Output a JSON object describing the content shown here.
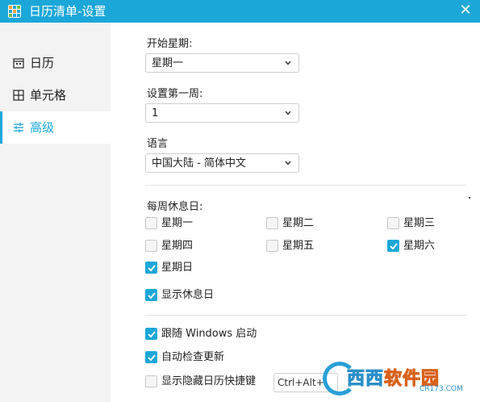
{
  "window": {
    "title": "日历清单-设置",
    "close_glyph": "✕"
  },
  "sidebar": {
    "items": [
      {
        "label": "日历",
        "icon": "calendar-icon",
        "active": false
      },
      {
        "label": "单元格",
        "icon": "grid-icon",
        "active": false
      },
      {
        "label": "高级",
        "icon": "sliders-icon",
        "active": true
      }
    ]
  },
  "settings": {
    "week_start": {
      "label": "开始星期:",
      "value": "星期一"
    },
    "first_week": {
      "label": "设置第一周:",
      "value": "1"
    },
    "language": {
      "label": "语言",
      "value": "中国大陆 - 简体中文"
    },
    "rest_days": {
      "label": "每周休息日:",
      "days": [
        {
          "label": "星期一",
          "checked": false
        },
        {
          "label": "星期二",
          "checked": false
        },
        {
          "label": "星期三",
          "checked": false
        },
        {
          "label": "星期四",
          "checked": false
        },
        {
          "label": "星期五",
          "checked": false
        },
        {
          "label": "星期六",
          "checked": true
        },
        {
          "label": "星期日",
          "checked": true
        }
      ]
    },
    "show_rest_days": {
      "label": "显示休息日",
      "checked": true
    },
    "auto_start": {
      "label": "跟随 Windows 启动",
      "checked": true
    },
    "auto_update": {
      "label": "自动检查更新",
      "checked": true
    },
    "hide_hotkey": {
      "label": "显示隐藏日历快捷键",
      "checked": false,
      "value": "Ctrl+Alt+"
    }
  },
  "watermark": {
    "text_left": "西西",
    "text_right": "软件园",
    "sub": "CR173.COM"
  },
  "colors": {
    "accent": "#1ba7d8",
    "sidebar_bg": "#f3f3f3"
  }
}
